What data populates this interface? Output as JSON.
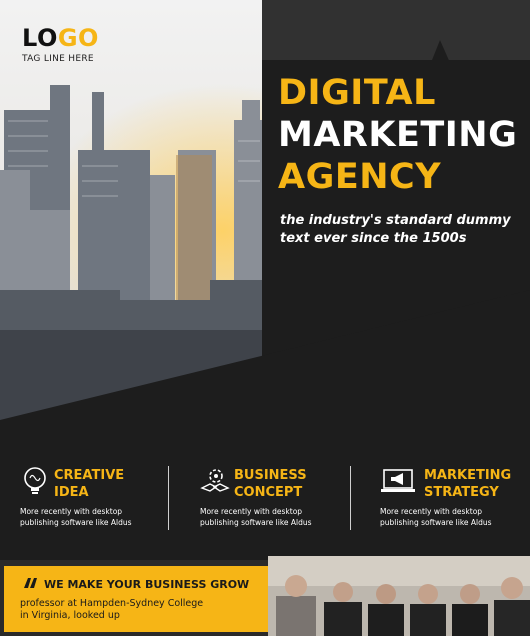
{
  "logo": {
    "text_main": "LO",
    "text_accent": "GO",
    "tagline": "TAG LINE HERE"
  },
  "headline": {
    "line1": "DIGITAL",
    "line2": "MARKETING",
    "line3": "AGENCY"
  },
  "tagline_text": {
    "line1": "the industry's standard dummy",
    "line2": "text  ever since the 1500s"
  },
  "services": [
    {
      "icon": "brain-bulb-icon",
      "title1": "CREATIVE",
      "title2": "IDEA",
      "desc1": "More recently with desktop",
      "desc2": "publishing software like Aldus"
    },
    {
      "icon": "hands-gear-icon",
      "title1": "BUSINESS",
      "title2": "CONCEPT",
      "desc1": "More recently with desktop",
      "desc2": "publishing software like Aldus"
    },
    {
      "icon": "laptop-megaphone-icon",
      "title1": "MARKETING",
      "title2": "STRATEGY",
      "desc1": "More recently with desktop",
      "desc2": "publishing software like Aldus"
    }
  ],
  "bottom": {
    "heading": "WE MAKE YOUR BUSINESS GROW",
    "line1": "professor at Hampden-Sydney College",
    "line2": "in Virginia, looked up"
  },
  "colors": {
    "accent": "#f6b516",
    "dark": "#1d1d1d",
    "white": "#ffffff"
  }
}
